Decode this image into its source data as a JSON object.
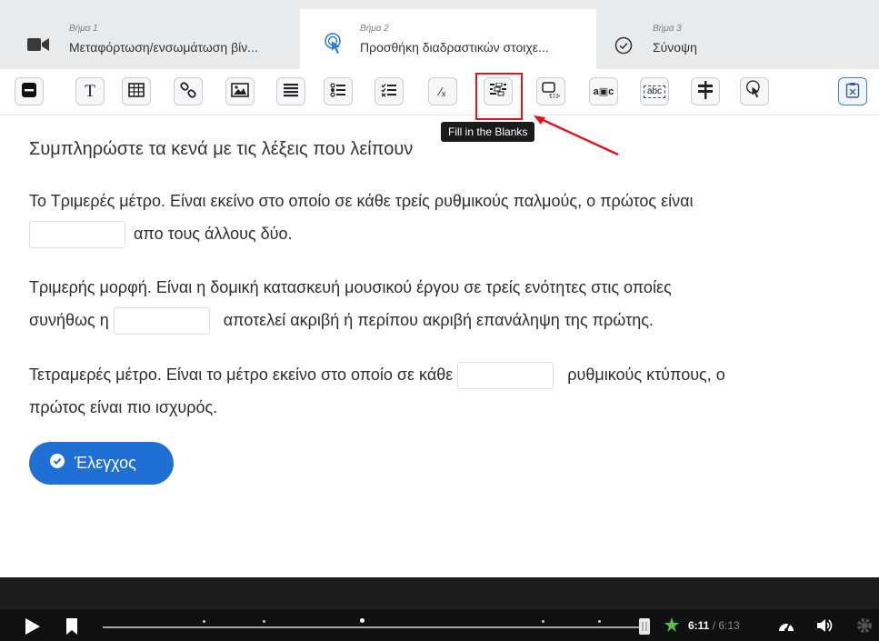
{
  "steps": [
    {
      "sub": "Βήμα 1",
      "label": "Μεταφόρτωση/ενσωμάτωση βίν...",
      "icon": "video-camera-icon"
    },
    {
      "sub": "Βήμα 2",
      "label": "Προσθήκη διαδραστικών στοιχε...",
      "icon": "touch-pointer-icon"
    },
    {
      "sub": "Βήμα 3",
      "label": "Σύνοψη",
      "icon": "check-circle-icon"
    }
  ],
  "toolbar": {
    "tools": [
      {
        "name": "label-tool",
        "icon": "minus-box-icon"
      },
      {
        "name": "text-tool",
        "icon": "text-icon",
        "glyph": "T"
      },
      {
        "name": "table-tool",
        "icon": "table-icon"
      },
      {
        "name": "link-tool",
        "icon": "link-icon"
      },
      {
        "name": "image-tool",
        "icon": "image-icon"
      },
      {
        "name": "statements-tool",
        "icon": "list-icon"
      },
      {
        "name": "single-choice-tool",
        "icon": "radio-list-icon"
      },
      {
        "name": "multiple-choice-tool",
        "icon": "checklist-icon"
      },
      {
        "name": "true-false-tool",
        "icon": "fraction-icon",
        "glyph": "⁄ₓ"
      },
      {
        "name": "fill-blanks-tool",
        "icon": "fill-blanks-icon"
      },
      {
        "name": "drag-drop-tool",
        "icon": "drag-drop-icon"
      },
      {
        "name": "mark-words-tool",
        "icon": "mark-words-icon",
        "glyph": "a▣c"
      },
      {
        "name": "drag-text-tool",
        "icon": "drag-text-icon",
        "glyph": "abc"
      },
      {
        "name": "crossroads-tool",
        "icon": "signpost-icon"
      },
      {
        "name": "navigation-hotspot-tool",
        "icon": "hotspot-icon"
      }
    ],
    "tooltip": "Fill in the Blanks"
  },
  "question": {
    "title": "Συμπληρώστε τα κενά με τις λέξεις που λείπουν",
    "p1_a": "Το Τριμερές μέτρο. Είναι εκείνο στο οποίο σε κάθε τρείς ρυθμικούς παλμούς, ο πρώτος είναι",
    "p1_b": "απο τους άλλους δύο.",
    "p2_a": "Τριμερής μορφή. Είναι η δομική κατασκευή  μουσικού έργου σε τρείς ενότητες στις οποίες",
    "p2_b": "συνήθως η",
    "p2_c": "αποτελεί ακριβή ή περίπου ακριβή επανάληψη της πρώτης.",
    "p3_a": "Τετραμερές μέτρο. Είναι το μέτρο εκείνο στο οποίο σε κάθε",
    "p3_b": "ρυθμικούς κτύπους, ο",
    "p3_c": "πρώτος είναι πιο ισχυρός.",
    "check_label": "Έλεγχος"
  },
  "player": {
    "current_time": "6:11",
    "separator": " / ",
    "total_time": "6:13",
    "progress": 0.997
  }
}
